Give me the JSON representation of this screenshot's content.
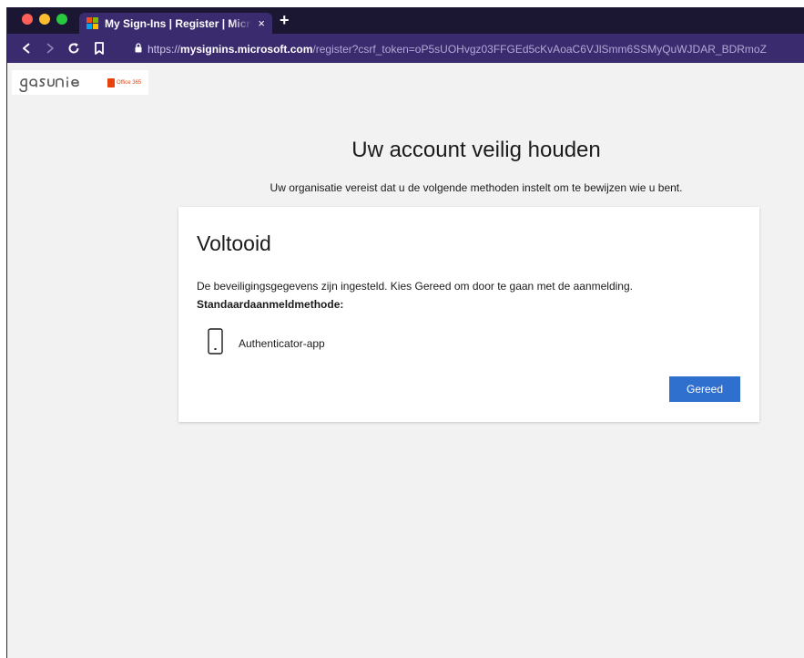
{
  "browser": {
    "tab": {
      "title": "My Sign-Ins | Register | Microso",
      "close_glyph": "×",
      "favicon": "microsoft-logo-icon",
      "favicon_colors": [
        "#f25022",
        "#7fba00",
        "#00a4ef",
        "#ffb900"
      ]
    },
    "new_tab_glyph": "+",
    "url": {
      "scheme": "https://",
      "host": "mysignins.microsoft.com",
      "path": "/register?csrf_token=oP5sUOHvgz03FFGEd5cKvAoaC6VJlSmm6SSMyQuWJDAR_BDRmoZ"
    },
    "colors": {
      "tabstrip": "#1b1632",
      "toolbar": "#3a2a6e"
    }
  },
  "brand": {
    "logo_text": "Gasunie",
    "office_text": "Office 365",
    "office_color": "#e8420c"
  },
  "page": {
    "headline": "Uw account veilig houden",
    "subline": "Uw organisatie vereist dat u de volgende methoden instelt om te bewijzen wie u bent."
  },
  "card": {
    "title": "Voltooid",
    "message": "De beveiligingsgegevens zijn ingesteld. Kies Gereed om door te gaan met de aanmelding.",
    "default_method_label": "Standaardaanmeldmethode:",
    "method": {
      "icon": "phone-icon",
      "name": "Authenticator-app"
    },
    "done_button": "Gereed",
    "accent": "#2f6fcd"
  }
}
